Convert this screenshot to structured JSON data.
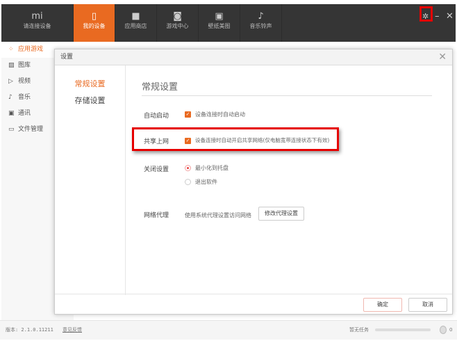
{
  "topbar": {
    "logo": "mi",
    "tabs": [
      {
        "label": "请连接设备",
        "icon": "mi-logo-icon"
      },
      {
        "label": "我的设备",
        "icon": "phone-icon",
        "active": true
      },
      {
        "label": "应用商店",
        "icon": "bag-icon"
      },
      {
        "label": "游戏中心",
        "icon": "gamepad-icon"
      },
      {
        "label": "壁纸美图",
        "icon": "picture-icon"
      },
      {
        "label": "音乐铃声",
        "icon": "music-note-icon"
      }
    ]
  },
  "sidebar": {
    "items": [
      {
        "label": "应用游戏",
        "icon": "apps-icon"
      },
      {
        "label": "图库",
        "icon": "image-icon"
      },
      {
        "label": "视频",
        "icon": "play-icon"
      },
      {
        "label": "音乐",
        "icon": "music-icon"
      },
      {
        "label": "通讯",
        "icon": "contact-icon"
      },
      {
        "label": "文件管理",
        "icon": "folder-icon"
      }
    ]
  },
  "dialog": {
    "title": "设置",
    "nav": [
      "常规设置",
      "存储设置"
    ],
    "section_title": "常规设置",
    "auto_start": {
      "label": "自动启动",
      "option": "设备连接时自动启动",
      "checked": true
    },
    "share": {
      "label": "共享上网",
      "option": "设备连接时自动开启共享网络(仅电脑宽带连接状态下有效)",
      "checked": true
    },
    "close": {
      "label": "关闭设置",
      "options": [
        "最小化到托盘",
        "退出软件"
      ],
      "selected": 0
    },
    "proxy": {
      "label": "网络代理",
      "text": "使用系统代理设置访问网络",
      "button": "修改代理设置"
    },
    "ok": "确定",
    "cancel": "取消"
  },
  "footer": {
    "version": "版本: 2.1.0.11211",
    "feedback": "意见反馈",
    "tasks": "暂无任务",
    "count": "0"
  },
  "colors": {
    "accent": "#e96a21",
    "highlight": "#e60000"
  }
}
